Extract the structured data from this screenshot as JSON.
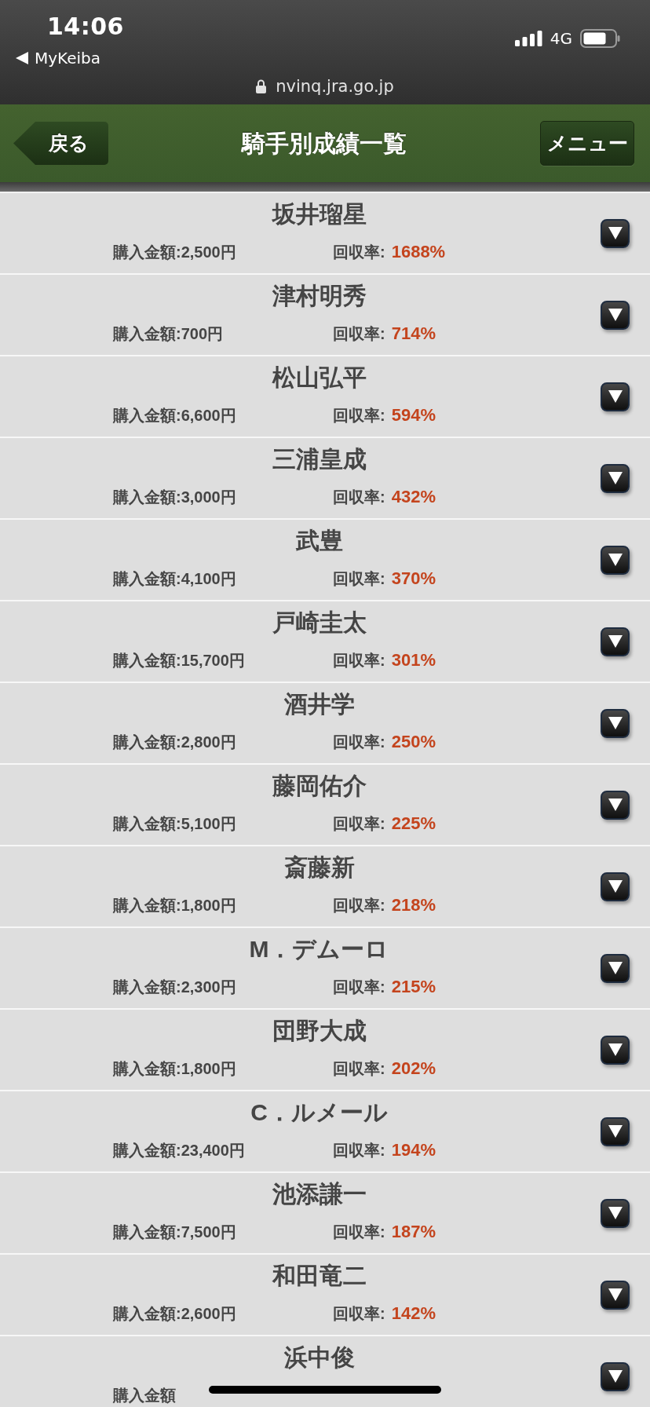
{
  "status_bar": {
    "time": "14:06",
    "back_app": "MyKeiba",
    "network": "4G"
  },
  "browser": {
    "url": "nvinq.jra.go.jp"
  },
  "header": {
    "back_button": "戻る",
    "title": "騎手別成績一覧",
    "menu_button": "メニュー"
  },
  "jockeys": [
    {
      "name": "坂井瑠星",
      "purchase": "購入金額:2,500円",
      "return_label": "回収率:",
      "return_rate": "1688%"
    },
    {
      "name": "津村明秀",
      "purchase": "購入金額:700円",
      "return_label": "回収率:",
      "return_rate": "714%"
    },
    {
      "name": "松山弘平",
      "purchase": "購入金額:6,600円",
      "return_label": "回収率:",
      "return_rate": "594%"
    },
    {
      "name": "三浦皇成",
      "purchase": "購入金額:3,000円",
      "return_label": "回収率:",
      "return_rate": "432%"
    },
    {
      "name": "武豊",
      "purchase": "購入金額:4,100円",
      "return_label": "回収率:",
      "return_rate": "370%"
    },
    {
      "name": "戸崎圭太",
      "purchase": "購入金額:15,700円",
      "return_label": "回収率:",
      "return_rate": "301%"
    },
    {
      "name": "酒井学",
      "purchase": "購入金額:2,800円",
      "return_label": "回収率:",
      "return_rate": "250%"
    },
    {
      "name": "藤岡佑介",
      "purchase": "購入金額:5,100円",
      "return_label": "回収率:",
      "return_rate": "225%"
    },
    {
      "name": "斎藤新",
      "purchase": "購入金額:1,800円",
      "return_label": "回収率:",
      "return_rate": "218%"
    },
    {
      "name": "M．デムーロ",
      "purchase": "購入金額:2,300円",
      "return_label": "回収率:",
      "return_rate": "215%"
    },
    {
      "name": "団野大成",
      "purchase": "購入金額:1,800円",
      "return_label": "回収率:",
      "return_rate": "202%"
    },
    {
      "name": "C．ルメール",
      "purchase": "購入金額:23,400円",
      "return_label": "回収率:",
      "return_rate": "194%"
    },
    {
      "name": "池添謙一",
      "purchase": "購入金額:7,500円",
      "return_label": "回収率:",
      "return_rate": "187%"
    },
    {
      "name": "和田竜二",
      "purchase": "購入金額:2,600円",
      "return_label": "回収率:",
      "return_rate": "142%"
    },
    {
      "name": "浜中俊",
      "purchase": "購入金額"
    }
  ]
}
